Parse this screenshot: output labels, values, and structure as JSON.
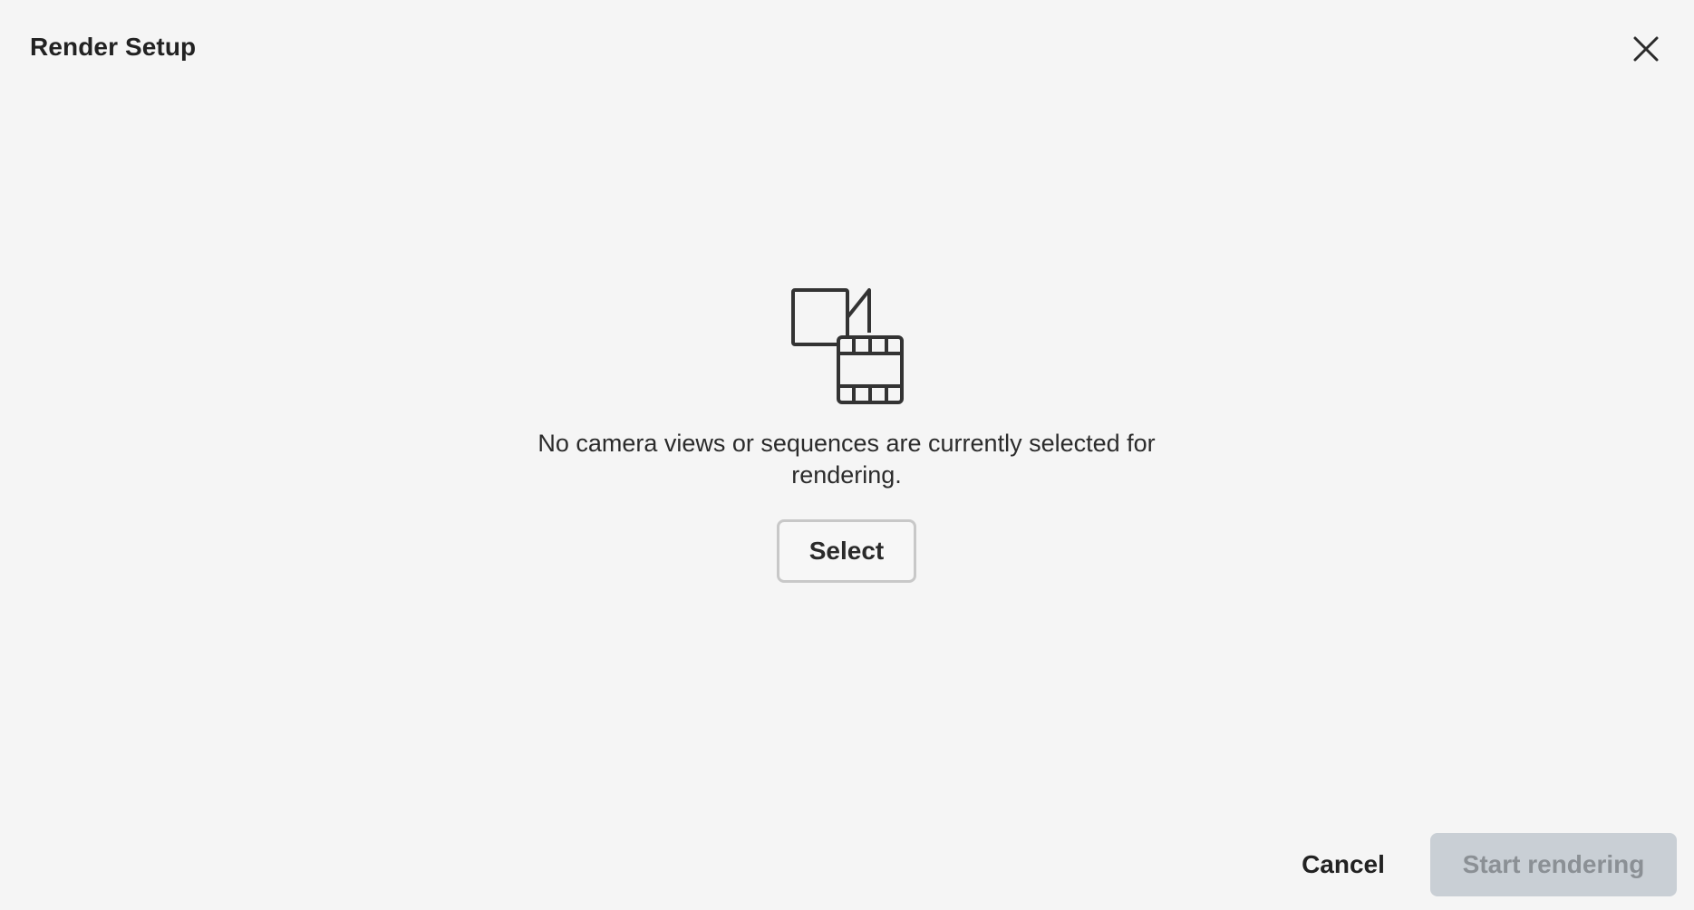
{
  "dialog": {
    "title": "Render Setup",
    "close_icon": "close-icon"
  },
  "empty_state": {
    "icon": "camera-film-icon",
    "message": "No camera views or sequences are currently selected for rendering.",
    "select_label": "Select"
  },
  "footer": {
    "cancel_label": "Cancel",
    "start_label": "Start rendering",
    "start_disabled": true
  },
  "colors": {
    "background": "#f5f5f5",
    "text": "#222222",
    "disabled_button_bg": "#c9cfd5",
    "disabled_button_text": "#8b9095",
    "select_border": "#c8c8c8"
  }
}
